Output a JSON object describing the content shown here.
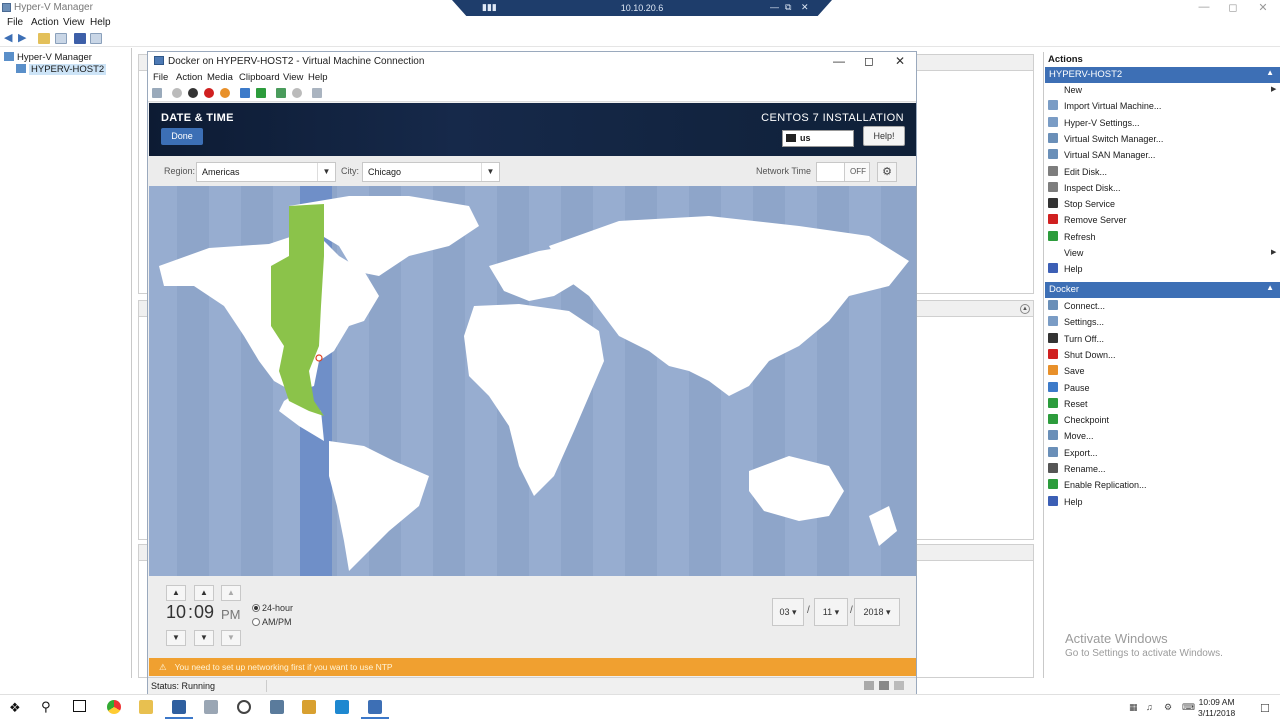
{
  "hyperv": {
    "title": "Hyper-V Manager",
    "menu": [
      "File",
      "Action",
      "View",
      "Help"
    ],
    "tree": {
      "root": "Hyper-V Manager",
      "host": "HYPERV-HOST2"
    },
    "actions_title": "Actions",
    "host_section": {
      "title": "HYPERV-HOST2",
      "items": [
        {
          "label": "New",
          "icon": "new-icon",
          "color": "#ffffff",
          "submenu": true
        },
        {
          "label": "Import Virtual Machine...",
          "icon": "import-icon",
          "color": "#7a9cc5"
        },
        {
          "label": "Hyper-V Settings...",
          "icon": "settings-icon",
          "color": "#7a9cc5"
        },
        {
          "label": "Virtual Switch Manager...",
          "icon": "switch-icon",
          "color": "#6a8fb8"
        },
        {
          "label": "Virtual SAN Manager...",
          "icon": "san-icon",
          "color": "#6a8fb8"
        },
        {
          "label": "Edit Disk...",
          "icon": "edit-disk-icon",
          "color": "#7d7d7d"
        },
        {
          "label": "Inspect Disk...",
          "icon": "inspect-disk-icon",
          "color": "#7d7d7d"
        },
        {
          "label": "Stop Service",
          "icon": "stop-icon",
          "color": "#333333"
        },
        {
          "label": "Remove Server",
          "icon": "remove-icon",
          "color": "#d02020"
        },
        {
          "label": "Refresh",
          "icon": "refresh-icon",
          "color": "#2c9c3c"
        },
        {
          "label": "View",
          "icon": "view-icon",
          "color": "#ffffff",
          "submenu": true
        },
        {
          "label": "Help",
          "icon": "help-icon",
          "color": "#3c5fb5"
        }
      ]
    },
    "vm_section": {
      "title": "Docker",
      "items": [
        {
          "label": "Connect...",
          "icon": "connect-icon",
          "color": "#6a8fb8"
        },
        {
          "label": "Settings...",
          "icon": "settings-icon",
          "color": "#7a9cc5"
        },
        {
          "label": "Turn Off...",
          "icon": "turn-off-icon",
          "color": "#333333"
        },
        {
          "label": "Shut Down...",
          "icon": "shut-down-icon",
          "color": "#d02020"
        },
        {
          "label": "Save",
          "icon": "save-icon",
          "color": "#e8902a"
        },
        {
          "label": "Pause",
          "icon": "pause-icon",
          "color": "#3c7ac9"
        },
        {
          "label": "Reset",
          "icon": "reset-icon",
          "color": "#2c9c3c"
        },
        {
          "label": "Checkpoint",
          "icon": "checkpoint-icon",
          "color": "#2c9c3c"
        },
        {
          "label": "Move...",
          "icon": "move-icon",
          "color": "#6a8fb8"
        },
        {
          "label": "Export...",
          "icon": "export-icon",
          "color": "#6a8fb8"
        },
        {
          "label": "Rename...",
          "icon": "rename-icon",
          "color": "#555555"
        },
        {
          "label": "Enable Replication...",
          "icon": "replication-icon",
          "color": "#2c9c3c"
        },
        {
          "label": "Help",
          "icon": "help-icon",
          "color": "#3c5fb5"
        }
      ]
    },
    "watermark": {
      "line1": "Activate Windows",
      "line2": "Go to Settings to activate Windows."
    }
  },
  "rdp": {
    "ip": "10.10.20.6"
  },
  "vm": {
    "title": "Docker on HYPERV-HOST2 - Virtual Machine Connection",
    "menu": [
      "File",
      "Action",
      "Media",
      "Clipboard",
      "View",
      "Help"
    ],
    "status": "Status: Running"
  },
  "anaconda": {
    "spoke_title": "DATE & TIME",
    "done_label": "Done",
    "product": "CENTOS 7 INSTALLATION",
    "keyboard": "us",
    "help_label": "Help!",
    "region_label": "Region:",
    "region_value": "Americas",
    "city_label": "City:",
    "city_value": "Chicago",
    "network_time_label": "Network Time",
    "network_time_state": "OFF",
    "hours": "10",
    "minutes": "09",
    "ampm": "PM",
    "format_24": "24-hour",
    "format_ampm": "AM/PM",
    "month": "03",
    "day": "11",
    "year": "2018",
    "date_sep": "/",
    "warning": "You need to set up networking first if you want to use NTP",
    "colors": {
      "ocean": "#8ea5c9",
      "land": "#ffffff",
      "selected_zone": "#8bc34a",
      "zone_band": "#6f8fc8",
      "warning": "#f0a030"
    }
  },
  "taskbar": {
    "time": "10:09 AM",
    "date": "3/11/2018"
  }
}
